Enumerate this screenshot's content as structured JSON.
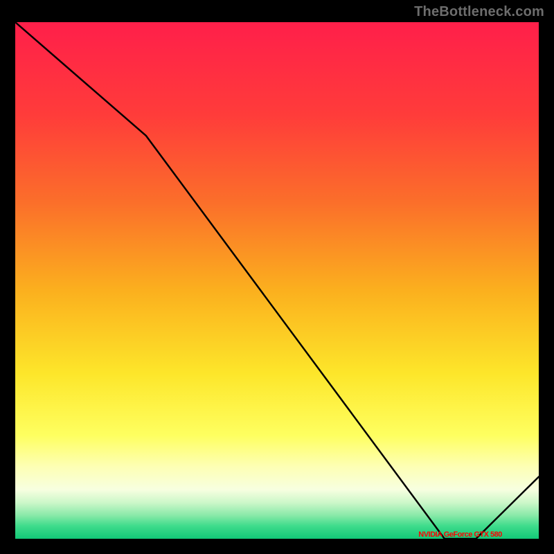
{
  "watermark": "TheBottleneck.com",
  "chart_data": {
    "type": "line",
    "title": "",
    "xlabel": "",
    "ylabel": "",
    "xlim": [
      0,
      100
    ],
    "ylim": [
      0,
      100
    ],
    "series": [
      {
        "name": "curve",
        "x": [
          0,
          25,
          82,
          88,
          100
        ],
        "values": [
          100,
          78,
          0,
          0,
          12
        ]
      }
    ],
    "annotations": [
      {
        "name": "nvidia-label",
        "label": "NVIDIA GeForce GTX 580",
        "x": 85,
        "y": 0
      }
    ],
    "gradient_stops": [
      {
        "offset": 0.0,
        "color": "#ff1f4a"
      },
      {
        "offset": 0.18,
        "color": "#ff3c3a"
      },
      {
        "offset": 0.35,
        "color": "#fb6f2a"
      },
      {
        "offset": 0.52,
        "color": "#fbb01e"
      },
      {
        "offset": 0.68,
        "color": "#fde62a"
      },
      {
        "offset": 0.8,
        "color": "#feff60"
      },
      {
        "offset": 0.86,
        "color": "#fdffb4"
      },
      {
        "offset": 0.905,
        "color": "#f7ffe0"
      },
      {
        "offset": 0.93,
        "color": "#ccf7c9"
      },
      {
        "offset": 0.955,
        "color": "#88e9a8"
      },
      {
        "offset": 0.975,
        "color": "#3fdc8c"
      },
      {
        "offset": 1.0,
        "color": "#12c877"
      }
    ]
  }
}
